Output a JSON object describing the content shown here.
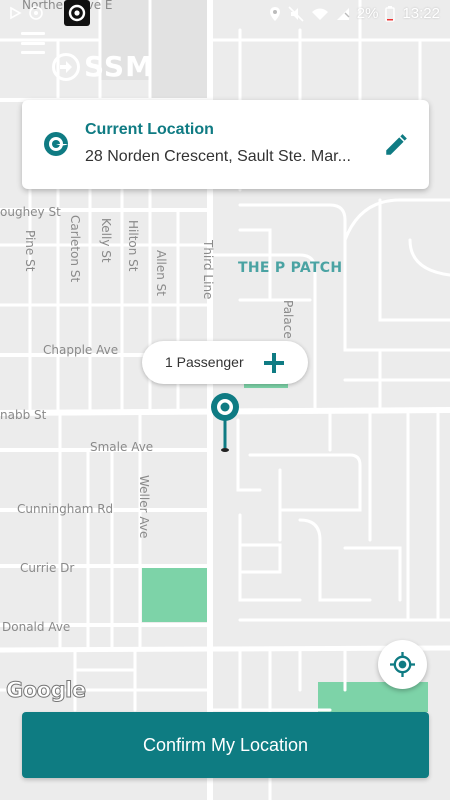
{
  "status_bar": {
    "battery_percent": "2%",
    "time": "13:22",
    "icons": [
      "location-icon",
      "mute-icon",
      "wifi-icon",
      "signal-icon",
      "battery-icon"
    ]
  },
  "header": {
    "brand": "SSM",
    "menu_icon": "hamburger-icon"
  },
  "location_card": {
    "title": "Current Location",
    "address": "28 Norden Crescent, Sault Ste. Mar...",
    "edit_icon": "pencil-icon"
  },
  "passenger": {
    "label": "1 Passenger",
    "add_icon": "plus-icon"
  },
  "map": {
    "attribution": "Google",
    "labels": {
      "northern_ave": "Northern Ave E",
      "p_patch": "THE P PATCH",
      "chapple_ave": "Chapple Ave",
      "smale_ave": "Smale Ave",
      "cunningham_rd": "Cunningham Rd",
      "currie_dr": "Currie Dr",
      "donald_ave": "Donald Ave",
      "mcnabb_st": "nabb St",
      "dougherty_st": "oughey St",
      "carleton_st": "Carleton St",
      "kelly_st": "Kelly St",
      "hilton_st": "Hilton St",
      "allen_st": "Allen St",
      "third_line": "Third Line",
      "pine_st": "Pine St",
      "weller_ave": "Weller Ave",
      "palace": "Palace"
    }
  },
  "colors": {
    "accent": "#0e7c82",
    "park": "#7dd3a8",
    "road": "#ffffff",
    "land": "#ececec"
  },
  "confirm_button": {
    "label": "Confirm My Location"
  }
}
